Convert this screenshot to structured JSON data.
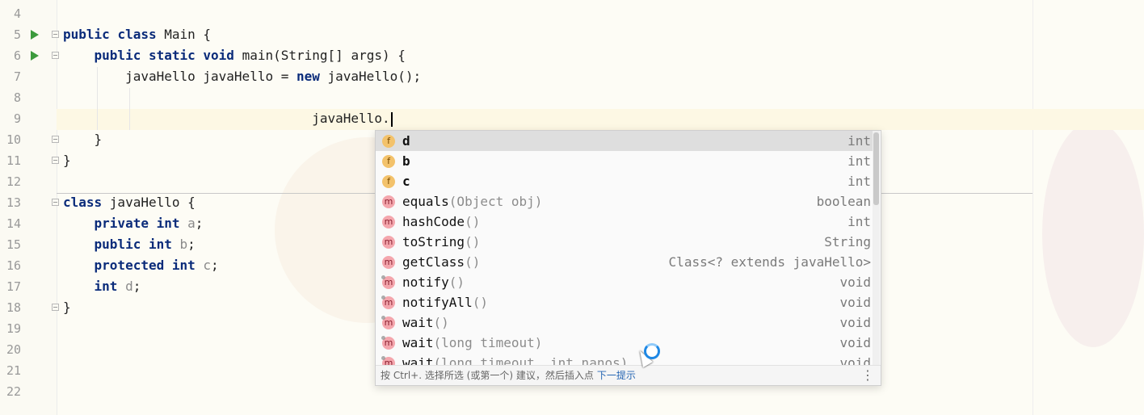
{
  "editor": {
    "lines": [
      {
        "n": "4"
      },
      {
        "n": "5",
        "run": true,
        "fold": true,
        "segments": [
          {
            "t": "public ",
            "k": true
          },
          {
            "t": "class ",
            "k": true
          },
          {
            "t": "Main {"
          }
        ]
      },
      {
        "n": "6",
        "run": true,
        "fold": true,
        "segments": [
          {
            "t": "    "
          },
          {
            "t": "public ",
            "k": true
          },
          {
            "t": "static ",
            "k": true
          },
          {
            "t": "void ",
            "k": true
          },
          {
            "t": "main(String[] args) {"
          }
        ]
      },
      {
        "n": "7",
        "segments": [
          {
            "t": "        javaHello javaHello = "
          },
          {
            "t": "new ",
            "k": true
          },
          {
            "t": "javaHello();"
          }
        ]
      },
      {
        "n": "8"
      },
      {
        "n": "9",
        "caret": true,
        "segments": [
          {
            "t": "                                javaHello."
          }
        ]
      },
      {
        "n": "10",
        "fold": true,
        "segments": [
          {
            "t": "    }"
          }
        ]
      },
      {
        "n": "11",
        "fold": true,
        "segments": [
          {
            "t": "}"
          }
        ]
      },
      {
        "n": "12"
      },
      {
        "n": "13",
        "fold": true,
        "segments": [
          {
            "t": "class ",
            "k": true
          },
          {
            "t": "javaHello {"
          }
        ]
      },
      {
        "n": "14",
        "segments": [
          {
            "t": "    "
          },
          {
            "t": "private ",
            "k": true
          },
          {
            "t": "int ",
            "k": true
          },
          {
            "t": "a",
            "f": true
          },
          {
            "t": ";"
          }
        ]
      },
      {
        "n": "15",
        "segments": [
          {
            "t": "    "
          },
          {
            "t": "public ",
            "k": true
          },
          {
            "t": "int ",
            "k": true
          },
          {
            "t": "b",
            "f": true
          },
          {
            "t": ";"
          }
        ]
      },
      {
        "n": "16",
        "segments": [
          {
            "t": "    "
          },
          {
            "t": "protected ",
            "k": true
          },
          {
            "t": "int ",
            "k": true
          },
          {
            "t": "c",
            "f": true
          },
          {
            "t": ";"
          }
        ]
      },
      {
        "n": "17",
        "segments": [
          {
            "t": "    "
          },
          {
            "t": "int ",
            "k": true
          },
          {
            "t": "d",
            "f": true
          },
          {
            "t": ";"
          }
        ]
      },
      {
        "n": "18",
        "fold": true,
        "segments": [
          {
            "t": "}"
          }
        ]
      },
      {
        "n": "19"
      },
      {
        "n": "20"
      },
      {
        "n": "21"
      },
      {
        "n": "22"
      }
    ]
  },
  "completion": {
    "items": [
      {
        "kind": "f",
        "name": "d",
        "params": "",
        "type": "int",
        "bold": true,
        "selected": true
      },
      {
        "kind": "f",
        "name": "b",
        "params": "",
        "type": "int",
        "bold": true
      },
      {
        "kind": "f",
        "name": "c",
        "params": "",
        "type": "int",
        "bold": true
      },
      {
        "kind": "m",
        "name": "equals",
        "params": "(Object obj)",
        "type": "boolean"
      },
      {
        "kind": "m",
        "name": "hashCode",
        "params": "()",
        "type": "int"
      },
      {
        "kind": "m",
        "name": "toString",
        "params": "()",
        "type": "String"
      },
      {
        "kind": "m",
        "name": "getClass",
        "params": "()",
        "type": "Class<? extends javaHello>"
      },
      {
        "kind": "m",
        "name": "notify",
        "params": "()",
        "type": "void",
        "lock": true
      },
      {
        "kind": "m",
        "name": "notifyAll",
        "params": "()",
        "type": "void",
        "lock": true
      },
      {
        "kind": "m",
        "name": "wait",
        "params": "()",
        "type": "void",
        "lock": true
      },
      {
        "kind": "m",
        "name": "wait",
        "params": "(long timeout)",
        "type": "void",
        "lock": true
      },
      {
        "kind": "m",
        "name": "wait",
        "params": "(long timeout, int nanos)",
        "type": "void",
        "lock": true
      }
    ],
    "footer": {
      "hint": "按 Ctrl+. 选择所选 (或第一个) 建议，然后插入点",
      "next_tip": "下一提示",
      "menu_glyph": "⋮"
    }
  }
}
